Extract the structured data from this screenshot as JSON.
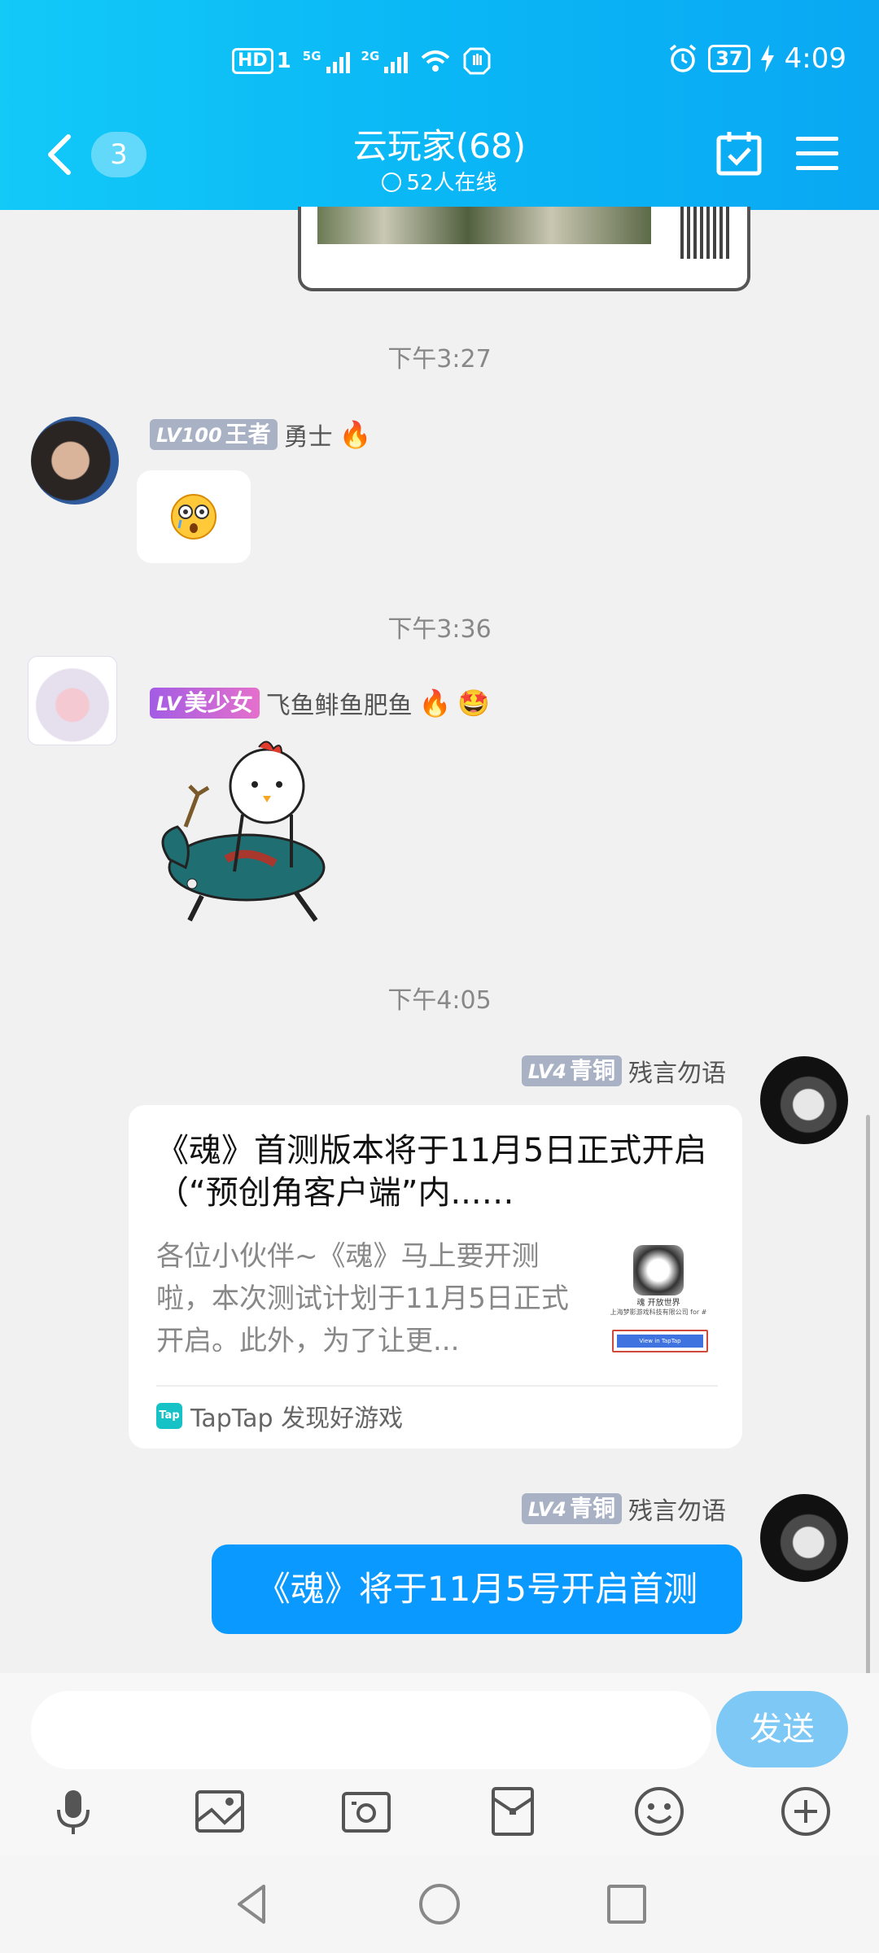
{
  "status_bar": {
    "hd": "HD",
    "sim": "1",
    "net1": "5G",
    "net2": "2G",
    "battery": "37",
    "time": "4:09"
  },
  "header": {
    "unread_count": "3",
    "title": "云玩家(68)",
    "online": "52人在线"
  },
  "messages": [
    {
      "time": "下午3:27",
      "level": "LV100",
      "rank": "王者",
      "sender": "勇士",
      "content_type": "emoji"
    },
    {
      "time": "下午3:36",
      "level": "LV",
      "rank": "美少女",
      "sender": "飞鱼鲱鱼肥鱼",
      "content_type": "sticker"
    },
    {
      "time": "下午4:05",
      "level": "LV4",
      "rank": "青铜",
      "sender": "残言勿语",
      "card": {
        "title": "《魂》首测版本将于11月5日正式开启（“预创角客户端”内...…",
        "desc": "各位小伙伴~《魂》马上要开测啦，本次测试计划于11月5日正式开启。此外，为了让更...",
        "thumb_text": "魂 开放世界",
        "thumb_company": "上海梦影游戏科技有限公司 for #",
        "thumb_button": "View in TapTap",
        "tap_logo": "Tap",
        "source": "TapTap 发现好游戏"
      }
    },
    {
      "level": "LV4",
      "rank": "青铜",
      "sender": "残言勿语",
      "text": "《魂》将于11月5号开启首测"
    }
  ],
  "input": {
    "placeholder": "",
    "send_label": "发送"
  },
  "colors": {
    "header": "#0ab7f5",
    "bubble": "#0a99ff",
    "send": "#7ec8f5"
  }
}
